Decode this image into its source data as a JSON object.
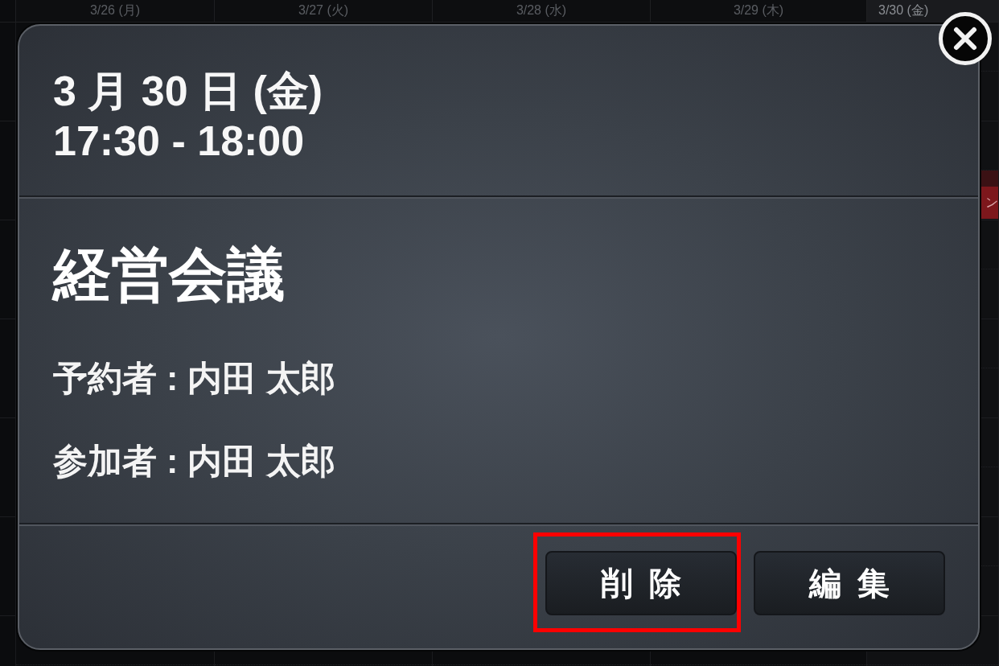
{
  "calendar": {
    "days": [
      {
        "label": "3/26 (月)",
        "selected": false
      },
      {
        "label": "3/27 (火)",
        "selected": false
      },
      {
        "label": "3/28 (水)",
        "selected": false
      },
      {
        "label": "3/29 (木)",
        "selected": false
      },
      {
        "label": "3/30 (金)",
        "selected": true
      }
    ],
    "events": [
      {
        "text": "ン"
      }
    ]
  },
  "dialog": {
    "date": "3 月 30 日 (金)",
    "time": "17:30 - 18:00",
    "title": "経営会議",
    "details": [
      "予約者 : 内田 太郎",
      "参加者 : 内田 太郎"
    ],
    "buttons": [
      {
        "label": "削除",
        "highlighted": true
      },
      {
        "label": "編集",
        "highlighted": false
      }
    ]
  }
}
